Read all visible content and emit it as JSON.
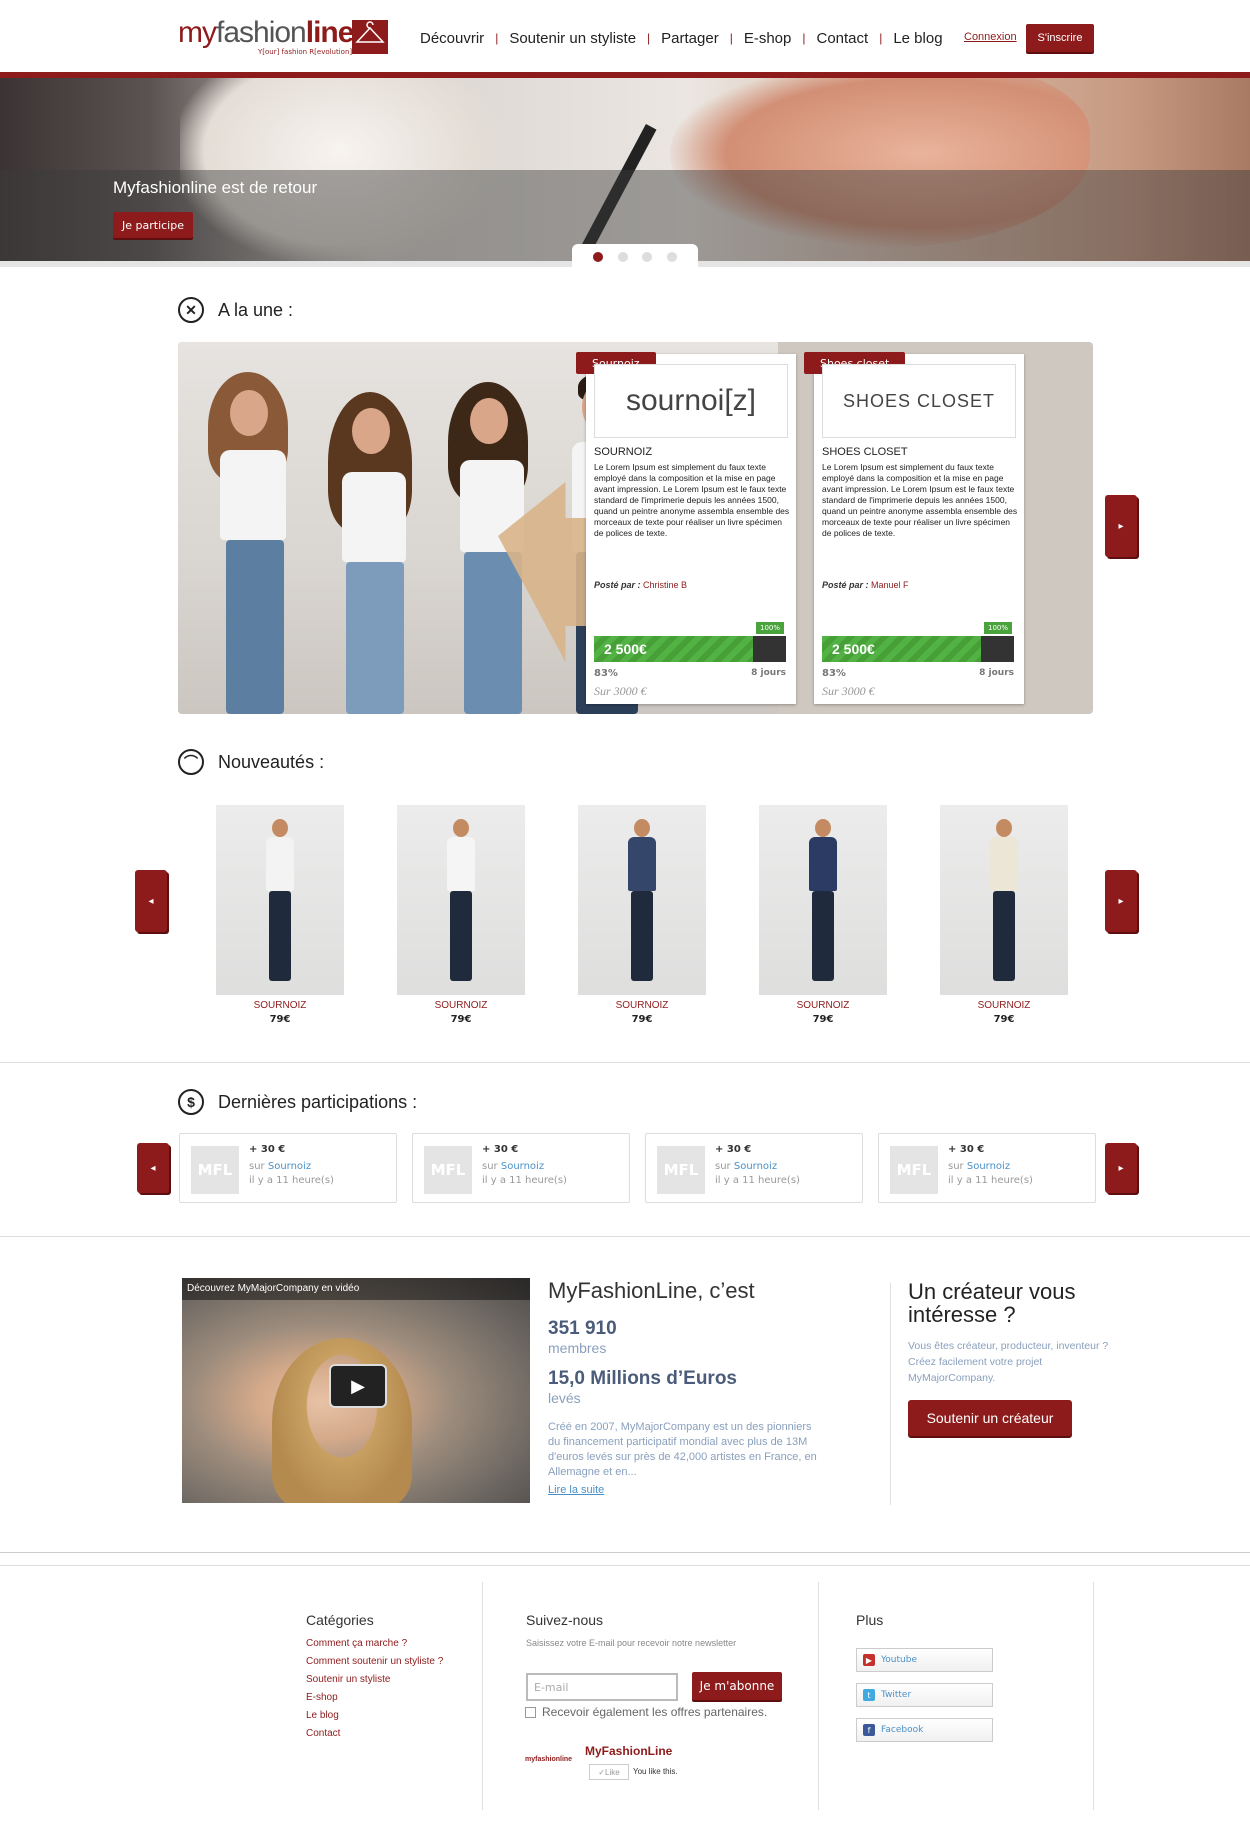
{
  "header": {
    "logo_text_1": "my",
    "logo_text_2": "fashion",
    "logo_text_3": "line",
    "logo_tagline": "Y[our] fashion R[evolution]",
    "nav": [
      "Découvrir",
      "Soutenir un styliste",
      "Partager",
      "E-shop",
      "Contact",
      "Le blog"
    ],
    "nav_sep": "|",
    "login": "Connexion",
    "signup": "S'inscrire"
  },
  "hero": {
    "title": "Myfashionline est de retour",
    "button": "Je participe",
    "slide_count": 4,
    "active_slide": 1
  },
  "featured": {
    "heading": "A la une :",
    "cards": [
      {
        "tab": "Sournoiz",
        "brand_logo": "sournoi[z]",
        "name": "SOURNOIZ",
        "desc": "Le Lorem Ipsum est simplement du faux texte employé dans la composition et la mise en page avant impression. Le Lorem Ipsum est le faux texte standard de l'imprimerie depuis les années 1500, quand un peintre anonyme assembla ensemble des morceaux de texte pour réaliser un livre spécimen de polices de texte.",
        "posted_label": "Posté par :",
        "posted_by": "Christine B",
        "badge": "100%",
        "amount": "2 500€",
        "progress": 0.83,
        "percent": "83%",
        "days": "8 jours",
        "goal": "Sur 3000 €"
      },
      {
        "tab": "Shoes closet",
        "brand_logo": "SHOES CLOSET",
        "name": "SHOES CLOSET",
        "desc": "Le Lorem Ipsum est simplement du faux texte employé dans la composition et la mise en page avant impression. Le Lorem Ipsum est le faux texte standard de l'imprimerie depuis les années 1500, quand un peintre anonyme assembla ensemble des morceaux de texte pour réaliser un livre spécimen de polices de texte.",
        "posted_label": "Posté par :",
        "posted_by": "Manuel F",
        "badge": "100%",
        "amount": "2 500€",
        "progress": 0.83,
        "percent": "83%",
        "days": "8 jours",
        "goal": "Sur 3000 €"
      }
    ],
    "next_icon": "▸"
  },
  "news": {
    "heading": "Nouveautés :",
    "prev_icon": "◂",
    "next_icon": "▸",
    "items": [
      {
        "name": "SOURNOIZ",
        "price": "79€",
        "top_color": "#f3f3f3"
      },
      {
        "name": "SOURNOIZ",
        "price": "79€",
        "top_color": "#f5f5f5"
      },
      {
        "name": "SOURNOIZ",
        "price": "79€",
        "top_color": "#34476a"
      },
      {
        "name": "SOURNOIZ",
        "price": "79€",
        "top_color": "#2c3b63"
      },
      {
        "name": "SOURNOIZ",
        "price": "79€",
        "top_color": "#ece6d6"
      }
    ]
  },
  "participations": {
    "heading": "Dernières participations :",
    "prev_icon": "◂",
    "next_icon": "▸",
    "items": [
      {
        "logo": "MFL",
        "amount": "+ 30 €",
        "sur": "sur",
        "brand": "Sournoiz",
        "time": "il y a 11 heure(s)"
      },
      {
        "logo": "MFL",
        "amount": "+ 30 €",
        "sur": "sur",
        "brand": "Sournoiz",
        "time": "il y a 11 heure(s)"
      },
      {
        "logo": "MFL",
        "amount": "+ 30 €",
        "sur": "sur",
        "brand": "Sournoiz",
        "time": "il y a 11 heure(s)"
      },
      {
        "logo": "MFL",
        "amount": "+ 30 €",
        "sur": "sur",
        "brand": "Sournoiz",
        "time": "il y a 11 heure(s)"
      }
    ]
  },
  "about": {
    "video_caption": "Découvrez MyMajorCompany en vidéo",
    "title": "MyFashionLine, c’est",
    "stat1_value": "351 910",
    "stat1_label": "membres",
    "stat2_value": "15,0 Millions d’Euros",
    "stat2_label": "levés",
    "text": "Créé en 2007, MyMajorCompany est un des pionniers du financement participatif mondial avec plus de 13M d'euros levés sur près de 42,000 artistes en France, en Allemagne et en...",
    "more": "Lire la suite"
  },
  "creator": {
    "title": "Un créateur vous intéresse ?",
    "text": "Vous êtes créateur, producteur, inventeur ? Créez facilement votre projet MyMajorCompany.",
    "button": "Soutenir un créateur"
  },
  "footer": {
    "categories_title": "Catégories",
    "categories": [
      "Comment ça marche ?",
      "Comment soutenir un styliste ?",
      "Soutenir un styliste",
      "E-shop",
      "Le blog",
      "Contact"
    ],
    "follow_title": "Suivez-nous",
    "follow_text": "Saisissez votre E-mail pour recevoir notre newsletter",
    "email_placeholder": "E-mail",
    "subscribe": "Je m'abonne",
    "partner_offer": "Recevoir également les offres partenaires.",
    "fb_name": "MyFashionLine",
    "fb_like": "Like",
    "fb_you_like": "You like this.",
    "more_title": "Plus",
    "social": [
      "Youtube",
      "Twitter",
      "Facebook"
    ]
  },
  "colors": {
    "brand": "#8e1b1b",
    "progress": "#52b243",
    "link": "#4a90c8"
  }
}
